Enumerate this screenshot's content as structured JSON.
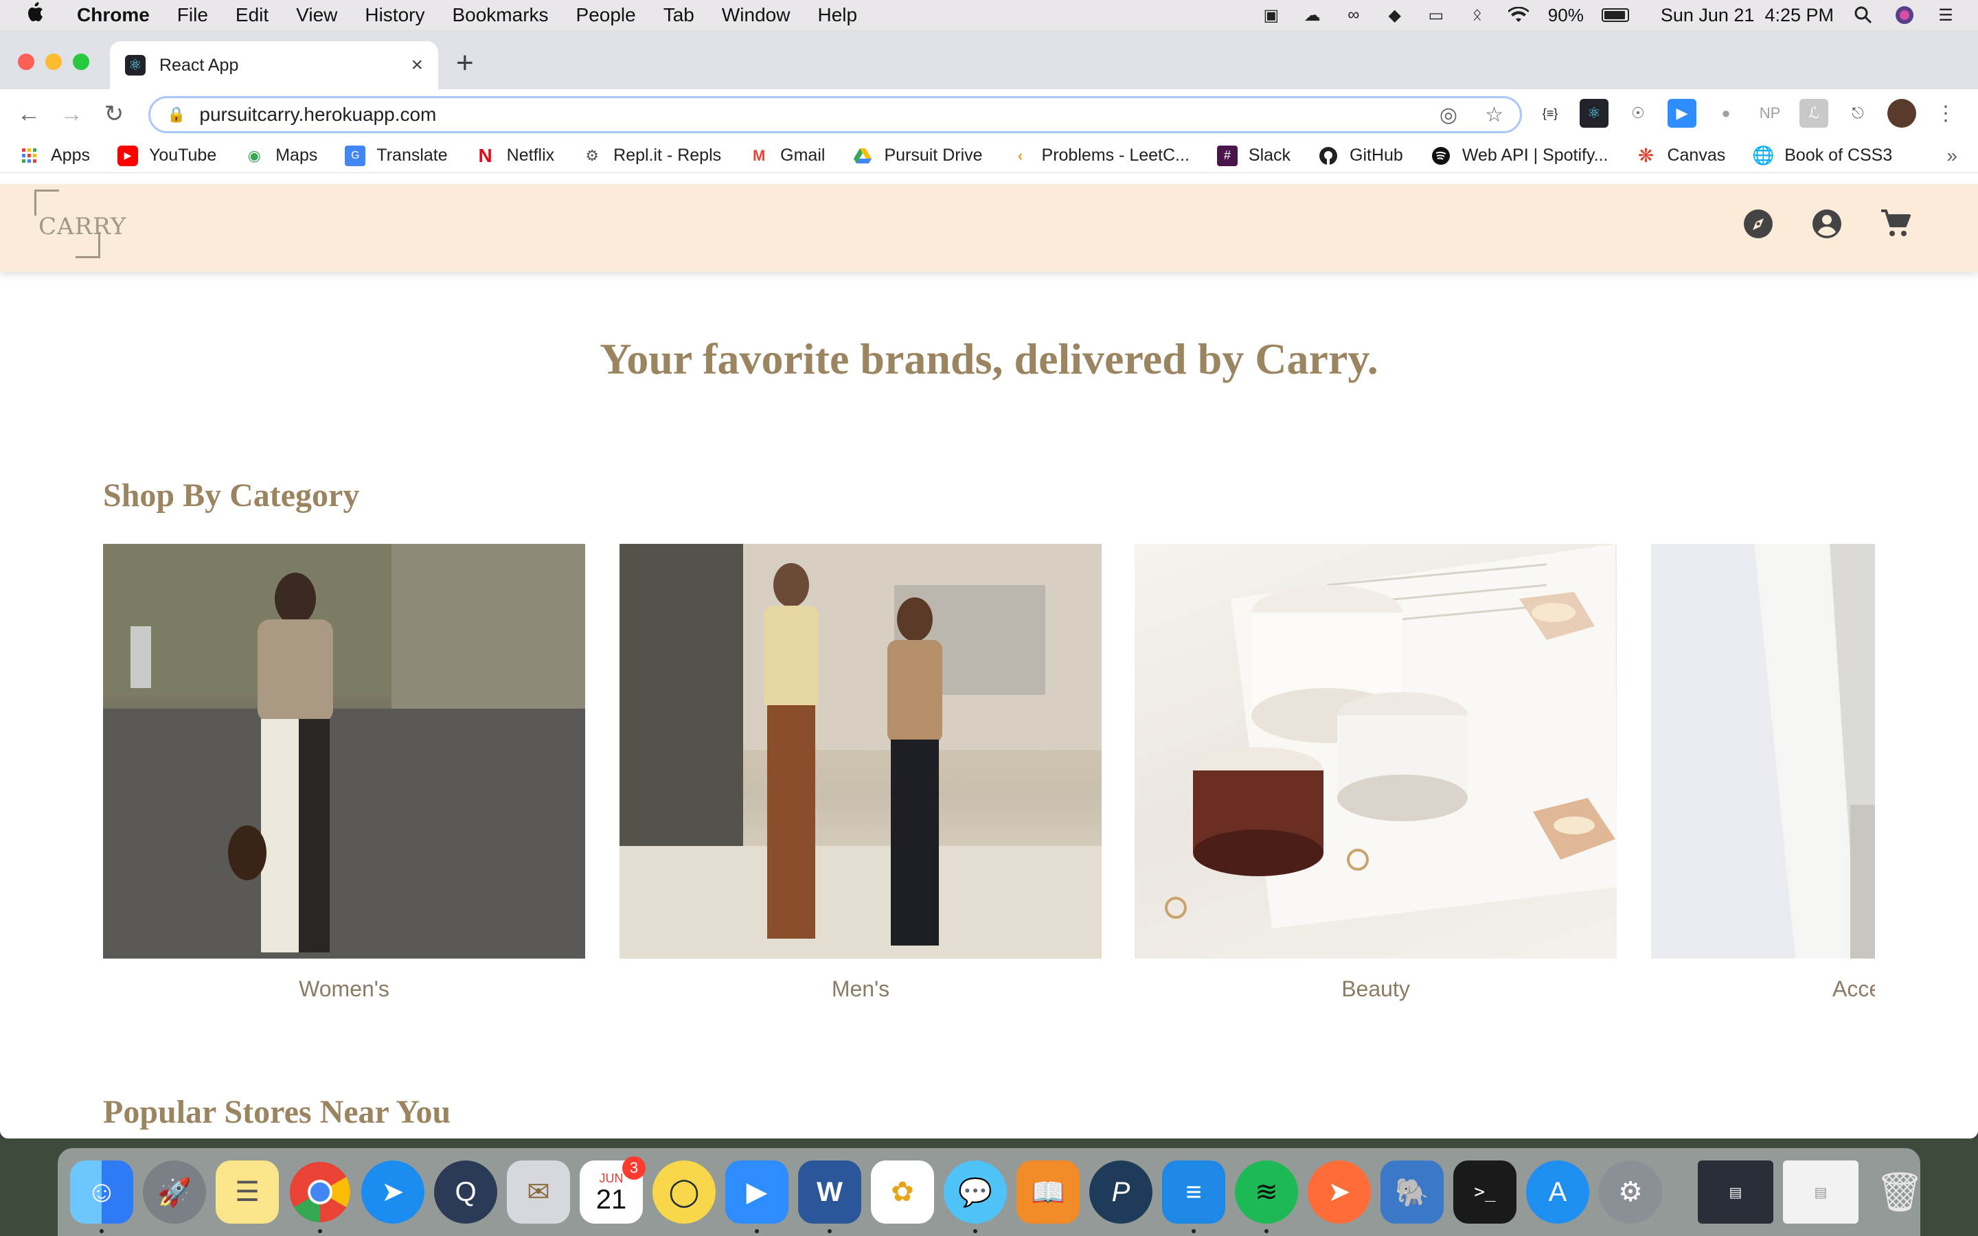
{
  "menubar": {
    "app_name": "Chrome",
    "items": [
      "File",
      "Edit",
      "View",
      "History",
      "Bookmarks",
      "People",
      "Tab",
      "Window",
      "Help"
    ],
    "battery": "90%",
    "datetime": "Sun Jun 21  4:25 PM"
  },
  "browser": {
    "tab_title": "React App",
    "url": "pursuitcarry.herokuapp.com",
    "bookmarks": [
      "Apps",
      "YouTube",
      "Maps",
      "Translate",
      "Netflix",
      "Repl.it - Repls",
      "Gmail",
      "Pursuit Drive",
      "Problems - LeetC...",
      "Slack",
      "GitHub",
      "Web API | Spotify...",
      "Canvas",
      "Book of CSS3"
    ],
    "bookmarks_more": "»",
    "extensions": [
      "{≡}",
      "NP"
    ]
  },
  "site": {
    "logo_text": "CARRY",
    "hero_title": "Your favorite brands, delivered by Carry.",
    "category_section_title": "Shop By Category",
    "categories": [
      "Women's",
      "Men's",
      "Beauty",
      "Acce"
    ],
    "stores_section_title": "Popular Stores Near You"
  },
  "dock": {
    "calendar_month": "JUN",
    "calendar_day": "21",
    "calendar_badge": "3"
  },
  "colors": {
    "header_bg": "#faecd9",
    "brand_text": "#9b8560",
    "category_label": "#8b7b63",
    "accent_bar": "#8fbab3"
  }
}
